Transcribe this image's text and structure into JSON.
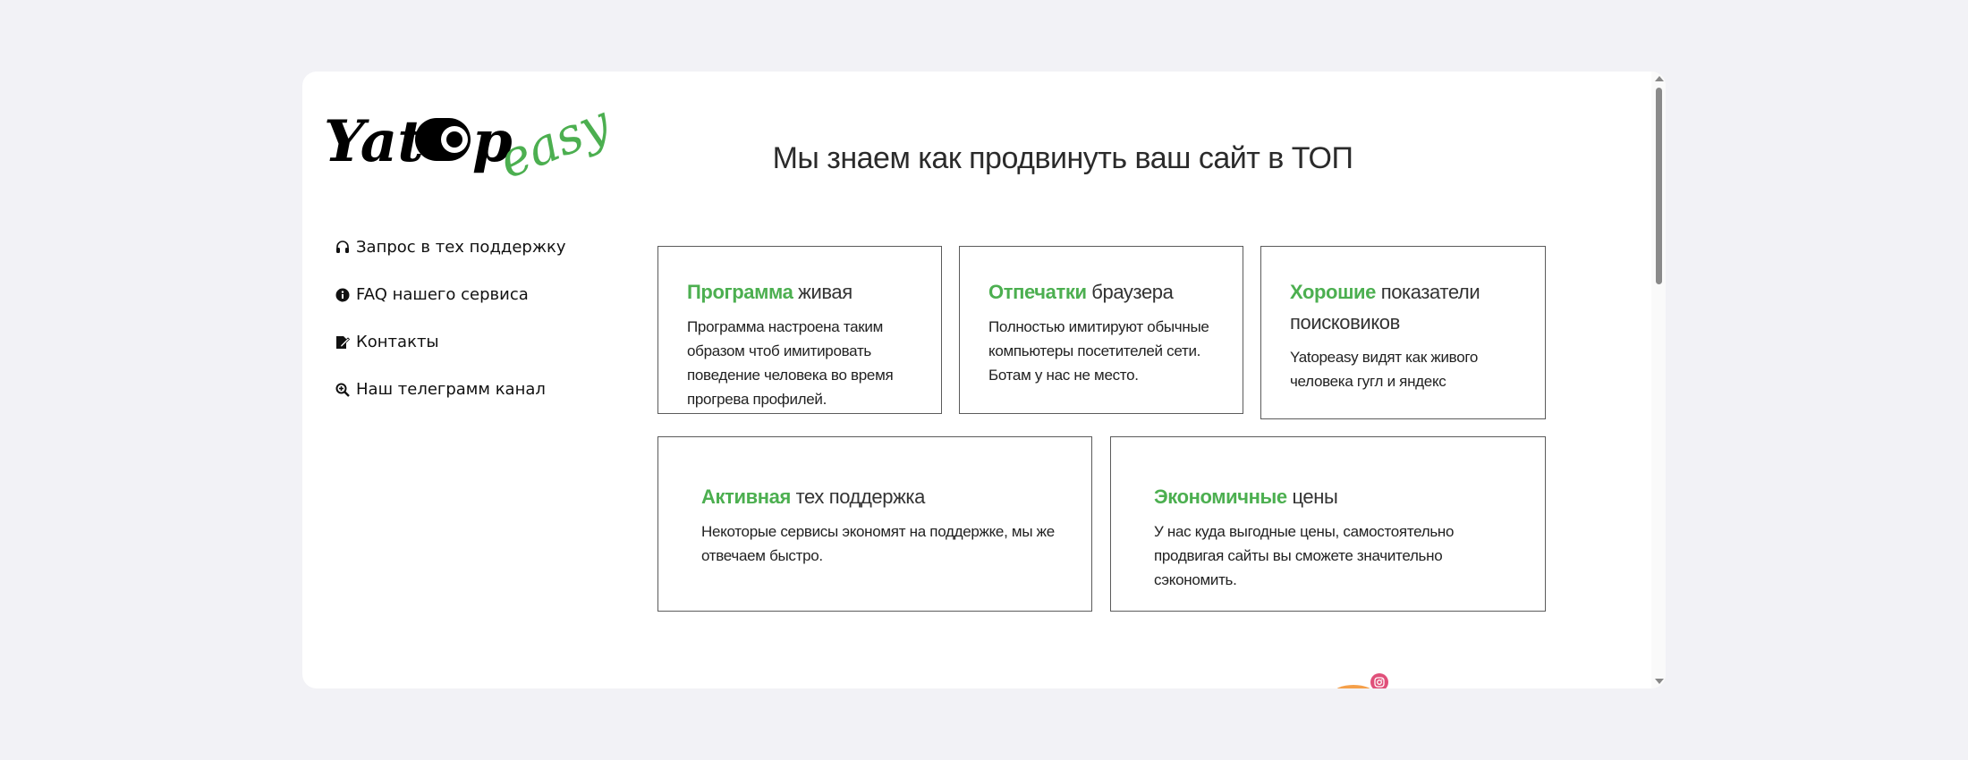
{
  "brand": {
    "logo_main": "Yat",
    "logo_p": "p",
    "logo_accent": "easy",
    "accent_color": "#4caf50"
  },
  "nav": {
    "items": [
      {
        "label": "Запрос в тех поддержку",
        "icon": "headset-icon"
      },
      {
        "label": "FAQ нашего сервиса",
        "icon": "info-circle-icon"
      },
      {
        "label": "Контакты",
        "icon": "edit-document-icon"
      },
      {
        "label": "Наш телеграмм канал",
        "icon": "search-plus-icon"
      }
    ]
  },
  "main": {
    "headline": "Мы знаем как продвинуть ваш сайт в ТОП",
    "features": [
      {
        "accent": "Программа",
        "rest": " живая",
        "text": "Программа настроена таким образом чтоб имитировать поведение человека во время прогрева профилей."
      },
      {
        "accent": "Отпечатки",
        "rest": " браузера",
        "text": "Полностью имитируют обычные компьютеры посетителей сети. Ботам у нас не место."
      },
      {
        "accent": "Хорошие",
        "rest": " показатели поисковиков",
        "text": "Yatopeasy видят как живого человека гугл и яндекс"
      },
      {
        "accent": "Активная",
        "rest": " тех поддержка",
        "text": "Некоторые сервисы экономят на поддержке, мы же отвечаем быстро."
      },
      {
        "accent": "Экономичные",
        "rest": " цены",
        "text": "У нас куда выгодные цены, самостоятельно продвигая сайты вы сможете значительно сэкономить."
      }
    ]
  },
  "floating": {
    "instagram_icon": "instagram-icon",
    "instagram_color": "#e0507a"
  }
}
